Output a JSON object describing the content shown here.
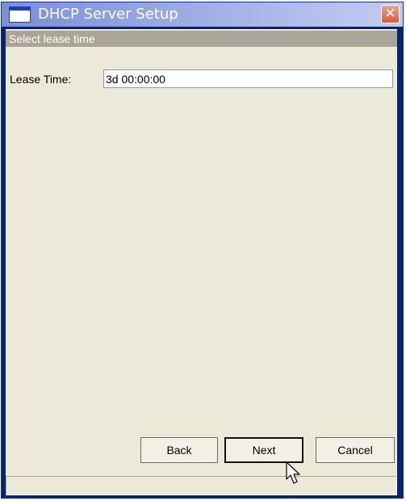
{
  "window": {
    "title": "DHCP Server Setup",
    "close_glyph": "✕"
  },
  "section": {
    "header": "Select lease time"
  },
  "form": {
    "lease_time_label": "Lease Time:",
    "lease_time_value": "3d 00:00:00"
  },
  "buttons": {
    "back": "Back",
    "next": "Next",
    "cancel": "Cancel"
  },
  "icons": {
    "window": "window-icon",
    "close": "close-icon",
    "cursor": "mouse-pointer-icon"
  },
  "colors": {
    "titlebar": "#a7b4e6",
    "section_header": "#aba598",
    "client_background": "#ece9d8",
    "close_button": "#d65a3a"
  }
}
